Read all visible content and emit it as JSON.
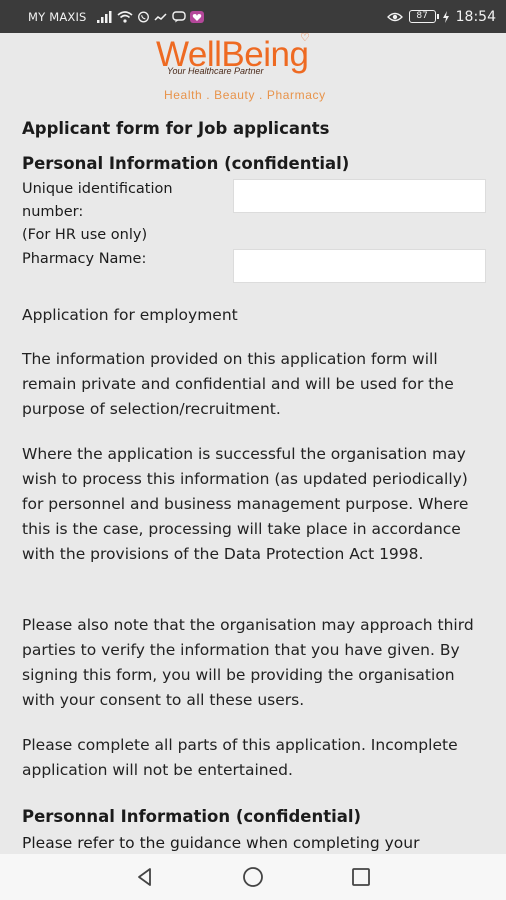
{
  "status_bar": {
    "carrier": "MY MAXIS",
    "battery": "87",
    "time": "18:54",
    "icons": [
      "signal-icon",
      "wifi-icon",
      "whatsapp-icon",
      "chart-icon",
      "chat-icon",
      "heart-app-icon"
    ],
    "right_icons": [
      "eye-icon",
      "battery-icon",
      "charging-icon"
    ]
  },
  "logo": {
    "name": "WellBeing",
    "tagline": "Your Healthcare Partner",
    "subtitle": "Health . Beauty . Pharmacy"
  },
  "form": {
    "title": "Applicant form for Job applicants",
    "section_title": "Personal Information (confidential)",
    "uid_label_1": "Unique identification",
    "uid_label_2": "number:",
    "uid_label_3": "(For HR use only)",
    "uid_value": "",
    "pharmacy_label": "Pharmacy Name:",
    "pharmacy_value": ""
  },
  "body": {
    "para_1": "Application for employment",
    "para_2": "The information provided on this application form will remain private and confidential and will be used for the purpose of selection/recruitment.",
    "para_3": "Where the application is successful the organisation may wish to process this information (as updated periodically) for personnel and business management purpose. Where this is the case, processing will take place in accordance with the provisions of the Data Protection Act 1998.",
    "para_4": "Please also note that the organisation may approach third parties to verify the information that you have given. By signing this form, you will be providing the organisation with your consent to all these users.",
    "para_5": "Please complete all parts of this application. Incomplete application will not be entertained.",
    "section_title_2": "Personnal Information (confidential)",
    "para_6": "Please refer to the guidance when completing your"
  },
  "nav": {
    "back": "back-icon",
    "home": "home-icon",
    "recents": "recents-icon"
  },
  "colors": {
    "brand": "#ee6a22",
    "brand_light": "#e8934a",
    "status_bar": "#3b3b3b",
    "background": "#e9e9e9"
  }
}
